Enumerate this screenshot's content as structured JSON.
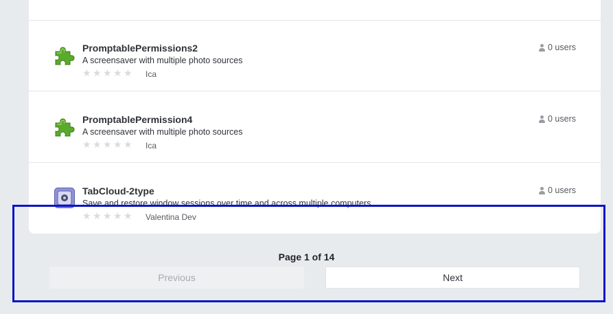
{
  "addons": [
    {
      "name": "PromptablePermissions2",
      "summary": "A screensaver with multiple photo sources",
      "author": "Ica",
      "users": "0 users",
      "icon": "puzzle-icon",
      "rating": 0
    },
    {
      "name": "PromptablePermission4",
      "summary": "A screensaver with multiple photo sources",
      "author": "Ica",
      "users": "0 users",
      "icon": "puzzle-icon",
      "rating": 0
    },
    {
      "name": "TabCloud-2type",
      "summary": "Save and restore window sessions over time and across multiple computers.",
      "author": "Valentina Dev",
      "users": "0 users",
      "icon": "tabcloud-app-icon",
      "rating": 0
    }
  ],
  "pagination": {
    "label": "Page 1 of 14",
    "previous": "Previous",
    "next": "Next"
  },
  "colors": {
    "highlight_border": "#0b14c7",
    "puzzle_green": "#5aaa2c"
  }
}
